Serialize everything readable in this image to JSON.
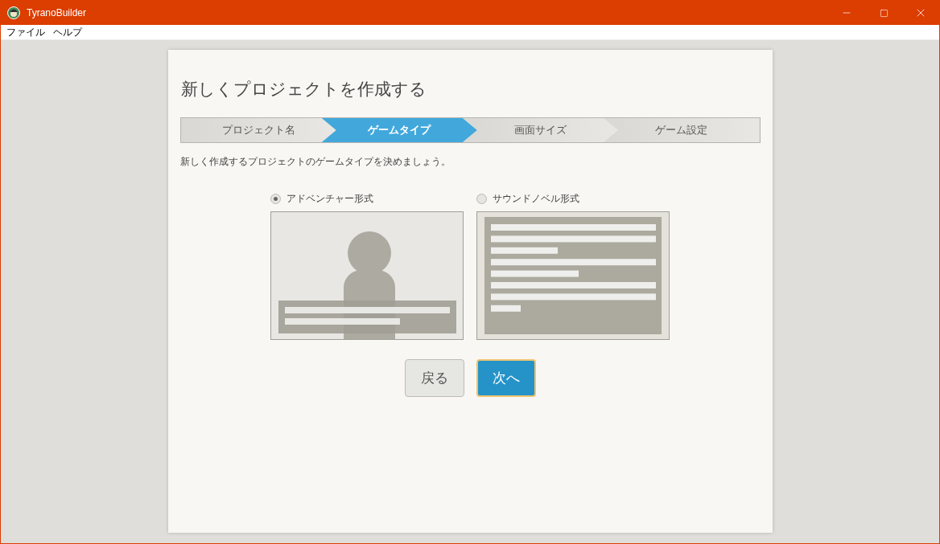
{
  "window": {
    "title": "TyranoBuilder"
  },
  "menu": [
    "ファイル",
    "ヘルプ"
  ],
  "dialog": {
    "title": "新しくプロジェクトを作成する",
    "steps": [
      {
        "label": "プロジェクト名",
        "selected": false
      },
      {
        "label": "ゲームタイプ",
        "selected": true
      },
      {
        "label": "画面サイズ",
        "selected": false
      },
      {
        "label": "ゲーム設定",
        "selected": false
      }
    ],
    "instruction": "新しく作成するプロジェクトのゲームタイプを決めましょう。",
    "options": [
      {
        "label": "アドベンチャー形式",
        "kind": "adventure",
        "selected": true
      },
      {
        "label": "サウンドノベル形式",
        "kind": "novel",
        "selected": false
      }
    ],
    "buttons": [
      {
        "label": "戻る",
        "kind": "secondary"
      },
      {
        "label": "次へ",
        "kind": "primary"
      }
    ]
  }
}
